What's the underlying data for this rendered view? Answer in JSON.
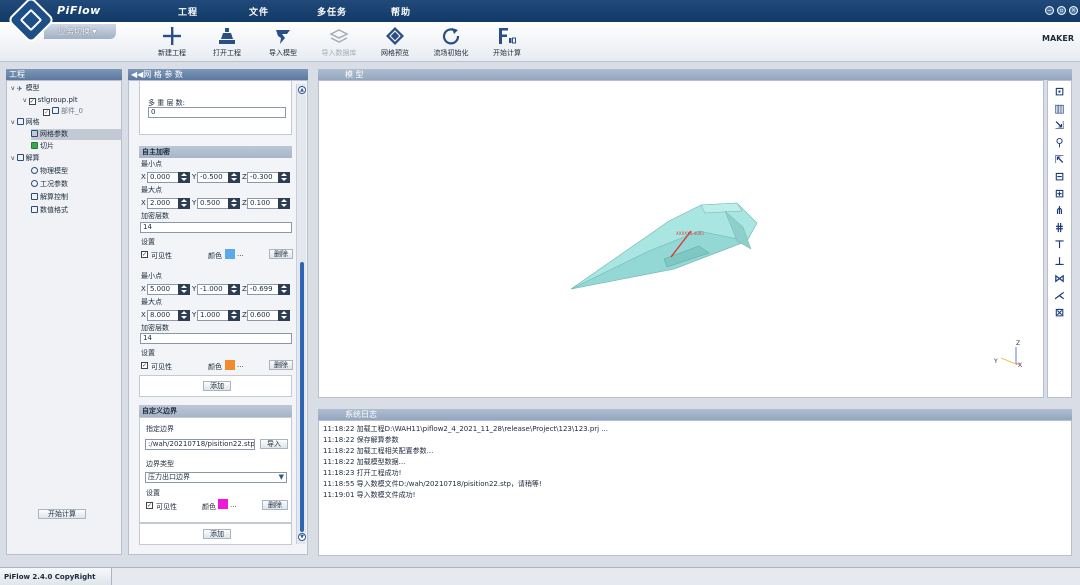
{
  "app": {
    "name": "PiFlow",
    "switch_label": "业务切换",
    "maker": "MAKER",
    "status": "PiFlow 2.4.0 CopyRight MAKER"
  },
  "menu": [
    "工程",
    "文件",
    "多任务",
    "帮助"
  ],
  "toolbar": [
    {
      "label": "新建工程",
      "icon": "plus-icon",
      "enabled": true
    },
    {
      "label": "打开工程",
      "icon": "open-project-icon",
      "enabled": true
    },
    {
      "label": "导入模型",
      "icon": "import-model-icon",
      "enabled": true
    },
    {
      "label": "导入数据库",
      "icon": "import-database-icon",
      "enabled": false
    },
    {
      "label": "网格预览",
      "icon": "mesh-preview-icon",
      "enabled": true
    },
    {
      "label": "流场初始化",
      "icon": "refresh-icon",
      "enabled": true
    },
    {
      "label": "开始计算",
      "icon": "start-calc-icon",
      "enabled": true
    }
  ],
  "tree": {
    "header": "工程",
    "items": [
      {
        "label": "模型",
        "level": 0,
        "expander": "v"
      },
      {
        "label": "stlgroup.plt",
        "level": 1,
        "expander": "v",
        "checked": true
      },
      {
        "label": "部件_0",
        "level": 2,
        "checked": true
      },
      {
        "label": "网格",
        "level": 0,
        "expander": "v"
      },
      {
        "label": "网格参数",
        "level": 1,
        "selected": true
      },
      {
        "label": "切片",
        "level": 1
      },
      {
        "label": "解算",
        "level": 0,
        "expander": "v"
      },
      {
        "label": "物理模型",
        "level": 1
      },
      {
        "label": "工况参数",
        "level": 1
      },
      {
        "label": "解算控制",
        "level": 1
      },
      {
        "label": "数值格式",
        "level": 1
      }
    ],
    "start_button": "开始计算"
  },
  "mesh": {
    "header": "◀◀网 格 参 数",
    "multi_layers_label": "多 重 层 数:",
    "multi_layers_value": "0",
    "refine_header": "自主加密",
    "min_label": "最小点",
    "max_label": "最大点",
    "layers_label": "加密层数",
    "settings_label": "设置",
    "visible_label": "可见性",
    "color_label": "颜色",
    "ellipsis": "...",
    "delete_label": "删除",
    "add_label": "添加",
    "axes": [
      "X",
      "Y",
      "Z"
    ],
    "boxes": [
      {
        "min": [
          "0.000",
          "-0.500",
          "-0.300"
        ],
        "max": [
          "2.000",
          "0.500",
          "0.100"
        ],
        "layers": "14",
        "color": "#5aa9ec"
      },
      {
        "min": [
          "5.000",
          "-1.000",
          "-0.699"
        ],
        "max": [
          "8.000",
          "1.000",
          "0.600"
        ],
        "layers": "14",
        "color": "#f28a30"
      }
    ],
    "custom_header": "自定义边界",
    "boundary_label": "指定边界",
    "boundary_file": ":/wah/20210718/pisition22.stp",
    "import_label": "导入",
    "boundary_type_label": "边界类型",
    "boundary_type": "压力出口边界",
    "custom_color": "#f018d8"
  },
  "viewport": {
    "title": "模  型",
    "model_label": "XXXXXX-4005",
    "axes": [
      "Y",
      "Z",
      "X"
    ]
  },
  "side_tools": [
    "view-1-icon",
    "view-2-icon",
    "view-3-icon",
    "view-4-icon",
    "view-5-icon",
    "view-6-icon",
    "view-7-icon",
    "view-8-icon",
    "view-9-icon",
    "view-10-icon",
    "view-11-icon",
    "view-12-icon",
    "view-13-icon",
    "view-14-icon"
  ],
  "log": {
    "title": "系统日志",
    "lines": [
      "11:18:22  加载工程D:\\WAH11\\piflow2_4_2021_11_28\\release\\Project\\123\\123.prj  ...",
      "11:18:22  保存解算参数",
      "11:18:22  加载工程相关配置参数...",
      "11:18:22  加载模型数据...",
      "11:18:23  打开工程成功!",
      "11:18:55  导入数模文件D:/wah/20210718/pisition22.stp，请稍等!",
      "11:19:01  导入数模文件成功!"
    ]
  }
}
